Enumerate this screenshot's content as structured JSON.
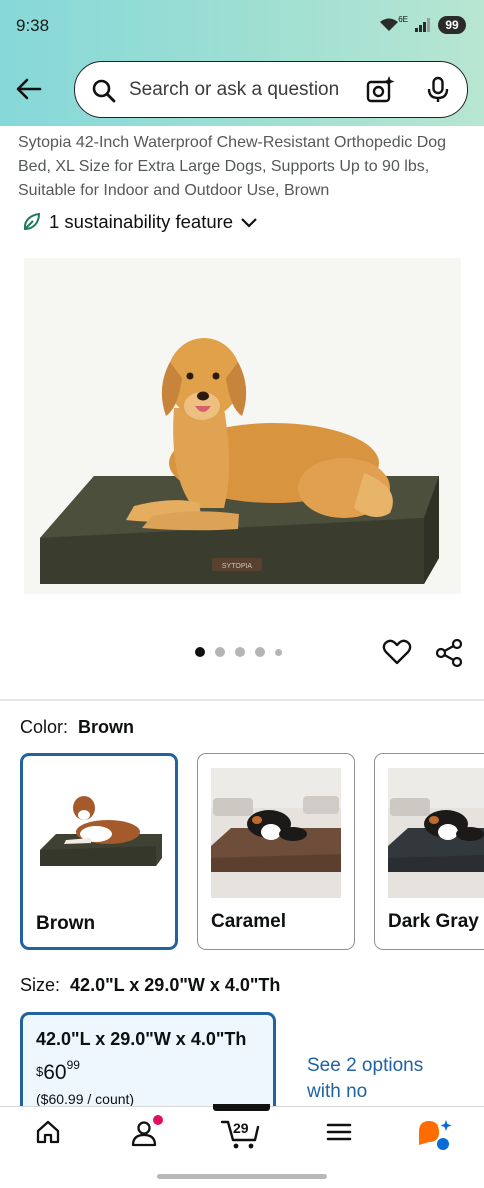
{
  "status_bar": {
    "time": "9:38",
    "battery": "99",
    "network": "6E"
  },
  "search": {
    "placeholder": "Search or ask a question"
  },
  "product": {
    "title": "Sytopia 42-Inch Waterproof Chew-Resistant Orthopedic Dog Bed, XL Size for Extra Large Dogs, Supports Up to 90 lbs, Suitable for Indoor and Outdoor Use, Brown",
    "sustainability": "1 sustainability feature",
    "image_logo_text": "SYTOPIA",
    "gallery": {
      "total_images": 5,
      "current_index": 0
    }
  },
  "color": {
    "label": "Color:",
    "selected": "Brown",
    "options": [
      {
        "name": "Brown",
        "bed_color": "#3f4132"
      },
      {
        "name": "Caramel",
        "bed_color": "#6e4d3a"
      },
      {
        "name": "Dark Gray",
        "bed_color": "#33383d"
      }
    ]
  },
  "size": {
    "label": "Size:",
    "selected": "42.0\"L x 29.0\"W x 4.0\"Th",
    "option": {
      "dimensions": "42.0\"L x 29.0\"W x 4.0\"Th",
      "price_currency": "$",
      "price_whole": "60",
      "price_fraction": "99",
      "unit_price": "($60.99 / count)"
    },
    "more_options": "See 2 options with no"
  },
  "nav": {
    "cart_count": "29",
    "items": [
      "home-icon",
      "account-icon",
      "cart-icon",
      "menu-icon",
      "rufus-icon"
    ]
  },
  "colors": {
    "link": "#2162a1",
    "selected_border": "#2162a1",
    "accent_orange": "#ff6d00",
    "notification": "#e0105e"
  }
}
